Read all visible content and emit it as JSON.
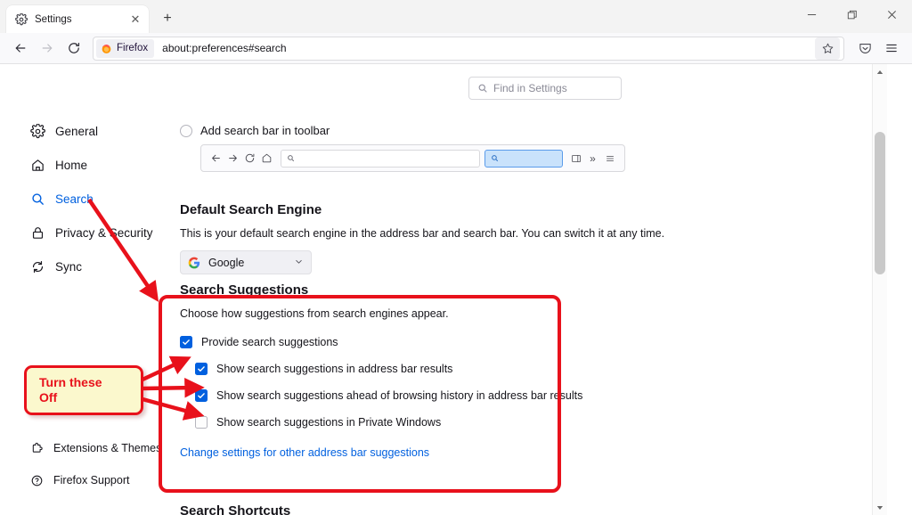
{
  "window": {
    "controls": [
      {
        "name": "minimize",
        "glyph": "—"
      },
      {
        "name": "maximize",
        "glyph": "❐"
      },
      {
        "name": "close",
        "glyph": "✕"
      }
    ]
  },
  "tabbar": {
    "tab_title": "Settings",
    "tab_favicon": "gear-icon",
    "close_glyph": "✕",
    "new_tab_glyph": "+"
  },
  "navbar": {
    "back_glyph": "←",
    "forward_glyph": "→",
    "reload_glyph": "↻",
    "brand_label": "Firefox",
    "url": "about:preferences#search",
    "star_icon": "bookmark-star-icon",
    "pocket_icon": "pocket-icon",
    "menu_glyph": "≡"
  },
  "sidebar": {
    "items": [
      {
        "label": "General",
        "icon": "gear-icon",
        "active": false
      },
      {
        "label": "Home",
        "icon": "home-icon",
        "active": false
      },
      {
        "label": "Search",
        "icon": "search-icon",
        "active": true
      },
      {
        "label": "Privacy & Security",
        "icon": "lock-icon",
        "active": false
      },
      {
        "label": "Sync",
        "icon": "sync-icon",
        "active": false
      }
    ],
    "footer_items": [
      {
        "label": "Extensions & Themes",
        "icon": "extension-puzzle-icon"
      },
      {
        "label": "Firefox Support",
        "icon": "question-circle-icon"
      }
    ]
  },
  "find": {
    "placeholder": "Find in Settings",
    "icon": "search-icon"
  },
  "search_bar_option": {
    "label": "Add search bar in toolbar",
    "selected": false
  },
  "toolbar_preview": {
    "back_glyph": "←",
    "forward_glyph": "→",
    "reload_glyph": "↻",
    "home_icon": "home-icon",
    "address_icon": "search-icon",
    "search_field_icon": "search-icon",
    "sidebar_icon": "sidebar-panel-icon",
    "overflow_glyph": "»",
    "menu_glyph": "≡"
  },
  "default_engine": {
    "heading": "Default Search Engine",
    "description": "This is your default search engine in the address bar and search bar. You can switch it at any time.",
    "selected": "Google",
    "selected_icon": "google-g-icon",
    "chevron_glyph": "⌄"
  },
  "search_suggestions": {
    "heading": "Search Suggestions",
    "description": "Choose how suggestions from search engines appear.",
    "options": [
      {
        "label": "Provide search suggestions",
        "checked": true,
        "indent": false
      },
      {
        "label": "Show search suggestions in address bar results",
        "checked": true,
        "indent": true
      },
      {
        "label": "Show search suggestions ahead of browsing history in address bar results",
        "checked": true,
        "indent": true
      },
      {
        "label": "Show search suggestions in Private Windows",
        "checked": false,
        "indent": true
      }
    ],
    "link": "Change settings for other address bar suggestions"
  },
  "search_shortcuts": {
    "heading": "Search Shortcuts"
  },
  "scrollbar": {
    "up_glyph": "▲",
    "down_glyph": "▼"
  },
  "annotations": {
    "callout_line1": "Turn these",
    "callout_line2": "Off",
    "highlight_color": "#e8111b",
    "callout_bg": "#fbf8cd",
    "arrow_color": "#e8111b"
  }
}
